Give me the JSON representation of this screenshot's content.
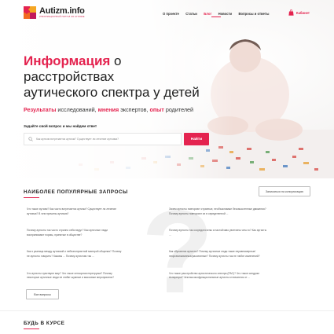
{
  "brand": {
    "name": "Autizm.info",
    "tagline": "ИНФОРМАЦИОННЫЙ ПОРТАЛ ОБ АУТИЗМЕ",
    "accent_color": "#e4234f"
  },
  "nav": {
    "items": [
      {
        "label": "О проекте",
        "active": false
      },
      {
        "label": "Статьи",
        "active": false
      },
      {
        "label": "Блог",
        "active": true
      },
      {
        "label": "Новости",
        "active": false
      },
      {
        "label": "Вопросы и ответы",
        "active": false
      }
    ],
    "cabinet_label": "Кабинет",
    "cabinet_icon": "shopping-bag-icon"
  },
  "hero": {
    "headline_accent": "Информация",
    "headline_rest_1": " о расстройствах",
    "headline_rest_2": "аутического спектра у детей",
    "sub_w1": "Результаты",
    "sub_t1": " исследований, ",
    "sub_w2": "мнения",
    "sub_t2": " экспертов, ",
    "sub_w3": "опыт",
    "sub_t3": " родителей",
    "ask_label": "Задайте свой вопрос и мы найдем ответ",
    "search_placeholder": "Как аутизм встречается аутизм? Существует ли лечение аутизма?",
    "search_button": "Найти",
    "search_icon": "magnifier-icon"
  },
  "popular": {
    "title": "НАИБОЛЕЕ ПОПУЛЯРНЫЕ ЗАПРОСЫ",
    "consult_button": "Записаться на консультацию",
    "all_questions_button": "Все вопросы",
    "left_questions": [
      [
        "Что такое аутизм? Как часто встречается аутизм? Существует ли лечение",
        "аутизма? В чем причины аутизма?"
      ],
      [
        "Почему аутисты так часто странно себя ведут? Как аутичные люди",
        "воспринимают нормы, принятые в обществе?"
      ],
      [
        "Как я разница между аутизмой и неблагоприятной манерой общения? Почему",
        "не аутисты говорить? Каковы ... Почему аутистам так ..."
      ],
      [
        "Что аутисты чувствуют мир? Что такое сенсорная перегрузка? Почему",
        "некоторые аутичные люди не любят шумные и массовые мероприятия?"
      ]
    ],
    "right_questions": [
      [
        "Зачем аутисты повторяют странные, необъяснимые бессмысленные движения?",
        "Почему аутисты повторяют их в определенной ..."
      ],
      [
        "Почему аутисты так сосредоточены и настойчиво увлечены чем-то? Как аутисты",
        "..."
      ],
      [
        "Как обучаются аутисты? Почему аутичные люди такие неравномерные/",
        "неорганизованные/рассеянные? Почему аутисты так не любят изменений?"
      ],
      [
        "Что такое расстройство аутистического спектра (РАС)? Что такое синдром",
        "Аспергера? Чем высокофункциональные аутисты отличаются от ..."
      ]
    ]
  },
  "next_section": {
    "title": "БУДЬ В КУРСЕ"
  }
}
